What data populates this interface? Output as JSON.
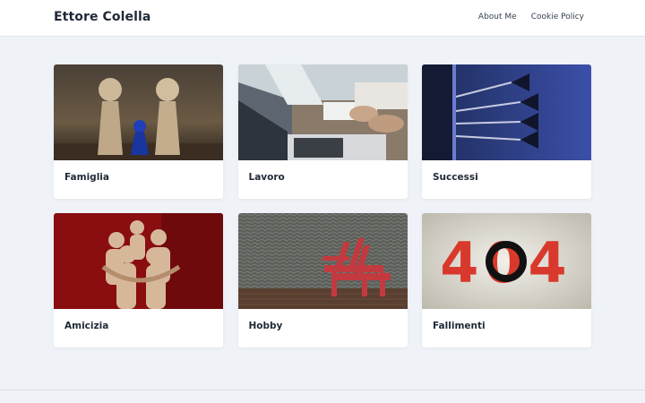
{
  "site": {
    "brand": "Ettore Colella"
  },
  "nav": {
    "items": [
      {
        "label": "About Me"
      },
      {
        "label": "Cookie Policy"
      }
    ]
  },
  "cards": [
    {
      "title": "Famiglia"
    },
    {
      "title": "Lavoro"
    },
    {
      "title": "Successi"
    },
    {
      "title": "Amicizia"
    },
    {
      "title": "Hobby"
    },
    {
      "title": "Fallimenti"
    }
  ],
  "image_text": {
    "error_code": "404"
  }
}
